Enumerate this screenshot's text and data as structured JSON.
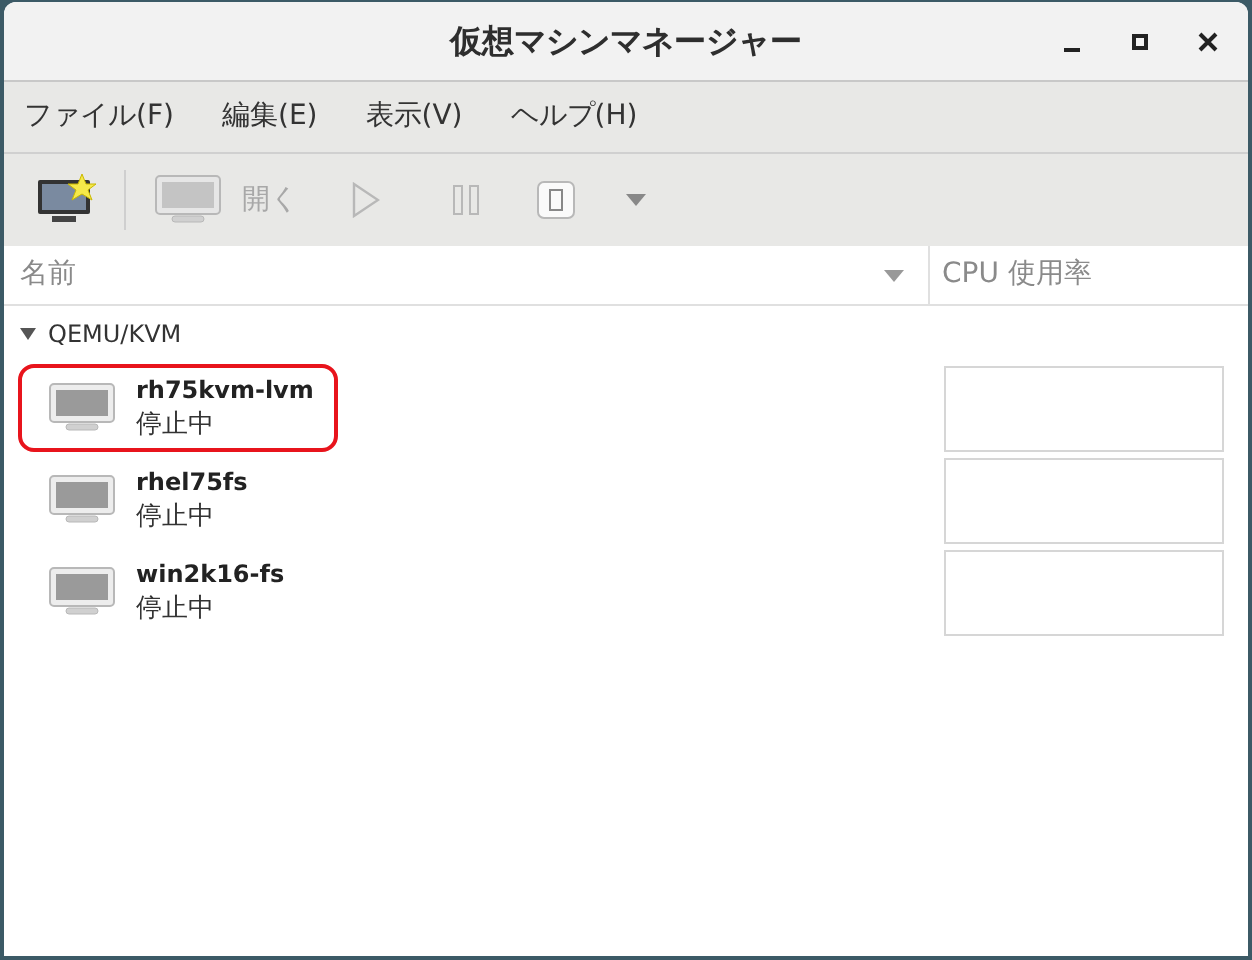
{
  "window": {
    "title": "仮想マシンマネージャー"
  },
  "menu": [
    "ファイル(F)",
    "編集(E)",
    "表示(V)",
    "ヘルプ(H)"
  ],
  "toolbar": [
    {
      "kind": "new",
      "disabled": false
    },
    {
      "kind": "open",
      "label": "開く",
      "disabled": true
    },
    {
      "kind": "run",
      "disabled": true
    },
    {
      "kind": "pause",
      "disabled": true
    },
    {
      "kind": "shutdown",
      "disabled": true
    },
    {
      "kind": "dropdown",
      "disabled": true
    }
  ],
  "table": {
    "columns": [
      "名前",
      "CPU 使用率"
    ],
    "group": {
      "label": "QEMU/KVM",
      "expanded": true
    },
    "rows": [
      {
        "name": "rh75kvm-lvm",
        "status": "停止中",
        "highlighted": true
      },
      {
        "name": "rhel75fs",
        "status": "停止中",
        "highlighted": false
      },
      {
        "name": "win2k16-fs",
        "status": "停止中",
        "highlighted": false
      }
    ]
  }
}
